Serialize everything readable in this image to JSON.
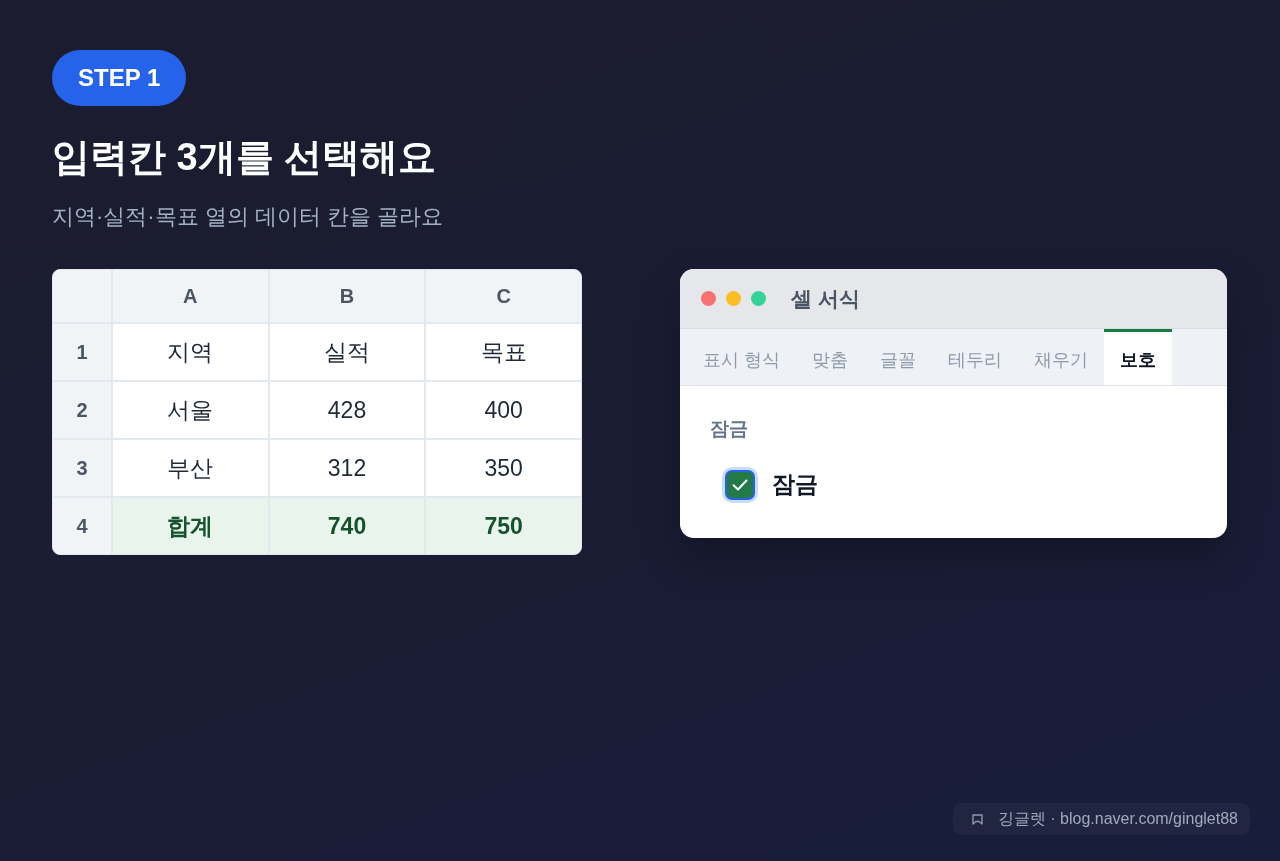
{
  "step_badge": {
    "label": "STEP 1"
  },
  "title": "입력칸 3개를 선택해요",
  "subtitle": "지역·실적·목표 열의 데이터 칸을 골라요",
  "spreadsheet": {
    "columns": [
      "A",
      "B",
      "C"
    ],
    "rows": [
      {
        "number": "1",
        "kind": "data",
        "cells": [
          "지역",
          "실적",
          "목표"
        ]
      },
      {
        "number": "2",
        "kind": "data",
        "cells": [
          "서울",
          "428",
          "400"
        ]
      },
      {
        "number": "3",
        "kind": "data",
        "cells": [
          "부산",
          "312",
          "350"
        ]
      },
      {
        "number": "4",
        "kind": "total",
        "cells": [
          "합계",
          "740",
          "750"
        ]
      }
    ]
  },
  "dialog": {
    "title": "셀 서식",
    "tabs": [
      {
        "label": "표시 형식",
        "selected": false
      },
      {
        "label": "맞춤",
        "selected": false
      },
      {
        "label": "글꼴",
        "selected": false
      },
      {
        "label": "테두리",
        "selected": false
      },
      {
        "label": "채우기",
        "selected": false
      },
      {
        "label": "보호",
        "selected": true
      }
    ],
    "section_label": "잠금",
    "checkbox": {
      "label": "잠금",
      "checked": true,
      "focused": true
    }
  },
  "credit": {
    "text": "깅글렛 · blog.naver.com/ginglet88"
  }
}
